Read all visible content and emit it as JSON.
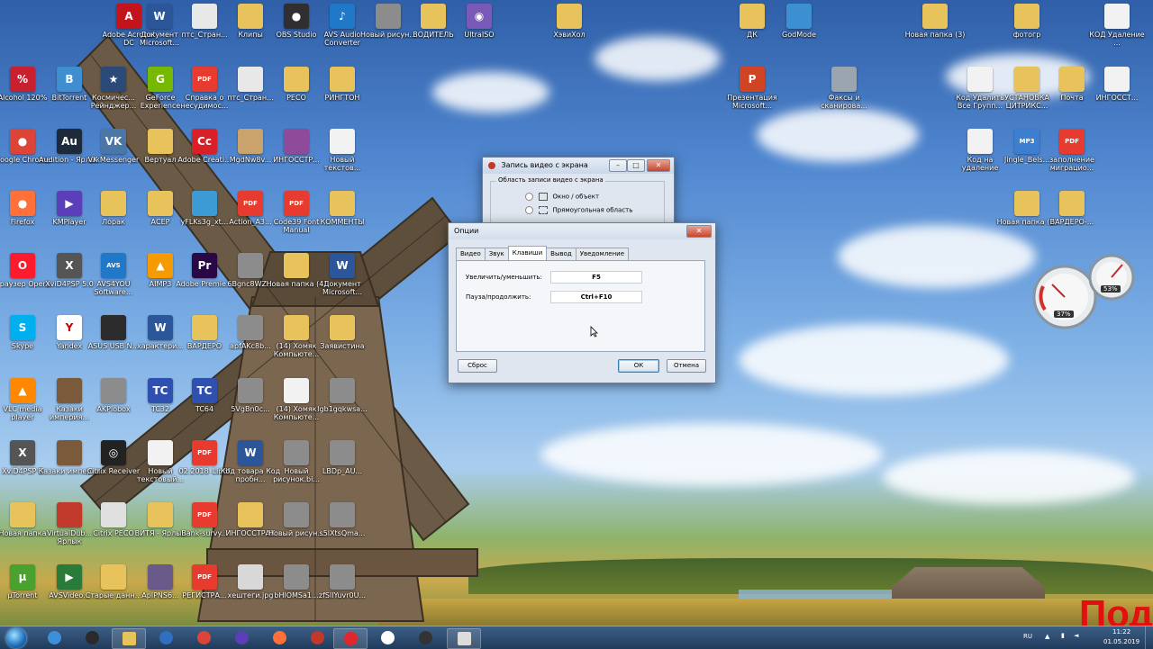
{
  "desktop": {
    "icons": [
      {
        "label": "Adobe Acrobat DC",
        "color": "#c4141b",
        "glyph": "A"
      },
      {
        "label": "Документ Microsoft...",
        "color": "#2b579a",
        "glyph": "W"
      },
      {
        "label": "птс_Стран...",
        "color": "#e8e8e8",
        "glyph": ""
      },
      {
        "label": "Клипы",
        "color": "#e8c25a",
        "glyph": ""
      },
      {
        "label": "OBS Studio",
        "color": "#302e31",
        "glyph": "●"
      },
      {
        "label": "AVS Audio Converter",
        "color": "#1f78c8",
        "glyph": "♪"
      },
      {
        "label": "Новый рисун...",
        "color": "#8c8c8c",
        "glyph": ""
      },
      {
        "label": "ВОДИТЕЛЬ",
        "color": "#e8c25a",
        "glyph": ""
      },
      {
        "label": "UltraISO",
        "color": "#7a5ab8",
        "glyph": "◉"
      },
      {
        "label": "ХэвиХол",
        "color": "#e8c25a",
        "glyph": ""
      },
      {
        "label": "ДК",
        "color": "#e8c25a",
        "glyph": ""
      },
      {
        "label": "GodMode",
        "color": "#3c8fd0",
        "glyph": ""
      },
      {
        "label": "Новая папка (3)",
        "color": "#e8c25a",
        "glyph": ""
      },
      {
        "label": "фотогр",
        "color": "#e8c25a",
        "glyph": ""
      },
      {
        "label": "КОД Удаление ...",
        "color": "#f2f2f2",
        "glyph": ""
      },
      {
        "label": "Alcohol 120%",
        "color": "#c8202f",
        "glyph": "%"
      },
      {
        "label": "BitTorrent",
        "color": "#3e8ed0",
        "glyph": "B"
      },
      {
        "label": "Космичес... Рейнджер...",
        "color": "#2b4a77",
        "glyph": "★"
      },
      {
        "label": "GeForce Experience",
        "color": "#76b900",
        "glyph": "G"
      },
      {
        "label": "Справка о несудимос...",
        "color": "#e63b2e",
        "glyph": "PDF"
      },
      {
        "label": "птс_Стран...",
        "color": "#e8e8e8",
        "glyph": ""
      },
      {
        "label": "РЕСО",
        "color": "#e8c25a",
        "glyph": ""
      },
      {
        "label": "РИНГТОН",
        "color": "#e8c25a",
        "glyph": ""
      },
      {
        "label": "Презентация Microsoft...",
        "color": "#d04423",
        "glyph": "P"
      },
      {
        "label": "Факсы и сканирова...",
        "color": "#9aa5b0",
        "glyph": ""
      },
      {
        "label": "Код Удалить Все Групп...",
        "color": "#f2f2f2",
        "glyph": ""
      },
      {
        "label": "УСТАНОВКА ЦИТРИКС...",
        "color": "#e8c25a",
        "glyph": ""
      },
      {
        "label": "Почта",
        "color": "#e8c25a",
        "glyph": ""
      },
      {
        "label": "ИНГОССТ...",
        "color": "#f2f2f2",
        "glyph": ""
      },
      {
        "label": "Google Chrome",
        "color": "#db4437",
        "glyph": "●"
      },
      {
        "label": "Audition - Ярлык",
        "color": "#1d2a3b",
        "glyph": "Au"
      },
      {
        "label": "VK Messenger",
        "color": "#4a76a8",
        "glyph": "VK"
      },
      {
        "label": "Вертуал",
        "color": "#e8c25a",
        "glyph": ""
      },
      {
        "label": "Adobe Creati...",
        "color": "#da1f26",
        "glyph": "Cc"
      },
      {
        "label": "MgdNw8v...",
        "color": "#c9a36b",
        "glyph": ""
      },
      {
        "label": "ИНГОССТР...",
        "color": "#8e4b9a",
        "glyph": ""
      },
      {
        "label": "Новый текстов...",
        "color": "#f2f2f2",
        "glyph": ""
      },
      {
        "label": "Код на удаление",
        "color": "#f2f2f2",
        "glyph": ""
      },
      {
        "label": "Jingle_Bels...",
        "color": "#3c7fd0",
        "glyph": "MP3"
      },
      {
        "label": "заполнение миграцио...",
        "color": "#e63b2e",
        "glyph": "PDF"
      },
      {
        "label": "Firefox",
        "color": "#ff7139",
        "glyph": "●"
      },
      {
        "label": "KMPlayer",
        "color": "#5b3fb8",
        "glyph": "▶"
      },
      {
        "label": "Лорак",
        "color": "#e8c25a",
        "glyph": ""
      },
      {
        "label": "АСЕР",
        "color": "#e8c25a",
        "glyph": ""
      },
      {
        "label": "yFLKs3g_xt...",
        "color": "#3c9bd4",
        "glyph": ""
      },
      {
        "label": "Action_A3...",
        "color": "#e63b2e",
        "glyph": "PDF"
      },
      {
        "label": "Code39 Font Manual",
        "color": "#e63b2e",
        "glyph": "PDF"
      },
      {
        "label": "КОММЕНТЫ",
        "color": "#e8c25a",
        "glyph": ""
      },
      {
        "label": "Новая папка (2)",
        "color": "#e8c25a",
        "glyph": ""
      },
      {
        "label": "ВАРДЕРО-...",
        "color": "#e8c25a",
        "glyph": ""
      },
      {
        "label": "Браузер Opera",
        "color": "#ff1b2d",
        "glyph": "O"
      },
      {
        "label": "XviD4PSP 5.0",
        "color": "#555555",
        "glyph": "X"
      },
      {
        "label": "AVS4YOU Software...",
        "color": "#1f78c8",
        "glyph": "AVS"
      },
      {
        "label": "AIMP3",
        "color": "#f59b00",
        "glyph": "▲"
      },
      {
        "label": "Adobe Premie...",
        "color": "#2a0845",
        "glyph": "Pr"
      },
      {
        "label": "6Bgnc8WZ...",
        "color": "#8c8c8c",
        "glyph": ""
      },
      {
        "label": "Новая папка (4)",
        "color": "#e8c25a",
        "glyph": ""
      },
      {
        "label": "Документ Microsoft...",
        "color": "#2b579a",
        "glyph": "W"
      },
      {
        "label": "Skype",
        "color": "#00aff0",
        "glyph": "S"
      },
      {
        "label": "Yandex",
        "color": "#ffffff",
        "glyph": "Y"
      },
      {
        "label": "ASUS USB N...",
        "color": "#2c2c2c",
        "glyph": ""
      },
      {
        "label": "характери...",
        "color": "#2b579a",
        "glyph": "W"
      },
      {
        "label": "ВАРДЕРО",
        "color": "#e8c25a",
        "glyph": ""
      },
      {
        "label": "apfAKc8b...",
        "color": "#8c8c8c",
        "glyph": ""
      },
      {
        "label": "(14) Хомяк Компьюте...",
        "color": "#e8c25a",
        "glyph": ""
      },
      {
        "label": "Заявистина",
        "color": "#e8c25a",
        "glyph": ""
      },
      {
        "label": "VLC media player",
        "color": "#ff8800",
        "glyph": "▲"
      },
      {
        "label": "Казаки империя...",
        "color": "#7a5a3a",
        "glyph": ""
      },
      {
        "label": "AKPlobox",
        "color": "#8c8c8c",
        "glyph": ""
      },
      {
        "label": "TC32",
        "color": "#3050b0",
        "glyph": "TC"
      },
      {
        "label": "TC64",
        "color": "#3050b0",
        "glyph": "TC"
      },
      {
        "label": "5VgBn0c...",
        "color": "#8c8c8c",
        "glyph": ""
      },
      {
        "label": "(14) Хомяк Компьюте...",
        "color": "#f2f2f2",
        "glyph": ""
      },
      {
        "label": "Igb1gqkwsa...",
        "color": "#8c8c8c",
        "glyph": ""
      },
      {
        "label": "XviD4PSP 5",
        "color": "#555555",
        "glyph": "X"
      },
      {
        "label": "Казаки империя",
        "color": "#7a5a3a",
        "glyph": ""
      },
      {
        "label": "Citrix Receiver",
        "color": "#222222",
        "glyph": "◎"
      },
      {
        "label": "Новый текстовый...",
        "color": "#f2f2f2",
        "glyph": ""
      },
      {
        "label": "02.2018_Lipdf",
        "color": "#e63b2e",
        "glyph": "PDF"
      },
      {
        "label": "Код товара Код пробн...",
        "color": "#2b579a",
        "glyph": "W"
      },
      {
        "label": "Новый рисунок.bi...",
        "color": "#8c8c8c",
        "glyph": ""
      },
      {
        "label": "LBDp_AU...",
        "color": "#8c8c8c",
        "glyph": ""
      },
      {
        "label": "Новая папка",
        "color": "#e8c25a",
        "glyph": ""
      },
      {
        "label": "VirtualDub... Ярлык",
        "color": "#c0392b",
        "glyph": ""
      },
      {
        "label": "Citrix РЕСО",
        "color": "#e0e0e0",
        "glyph": ""
      },
      {
        "label": "ВИТЯ - Ярлык",
        "color": "#e8c25a",
        "glyph": ""
      },
      {
        "label": "Bank-survy...",
        "color": "#e63b2e",
        "glyph": "PDF"
      },
      {
        "label": "ИНГОССТРАХ",
        "color": "#e8c25a",
        "glyph": ""
      },
      {
        "label": "Новый рисун...",
        "color": "#8c8c8c",
        "glyph": ""
      },
      {
        "label": "s5lXtsQma...",
        "color": "#8c8c8c",
        "glyph": ""
      },
      {
        "label": "µTorrent",
        "color": "#49a22e",
        "glyph": "µ"
      },
      {
        "label": "AVSVideo...",
        "color": "#2a7a3a",
        "glyph": "▶"
      },
      {
        "label": "Старые данн...",
        "color": "#e8c25a",
        "glyph": ""
      },
      {
        "label": "AplPNS6...",
        "color": "#6a5a8a",
        "glyph": ""
      },
      {
        "label": "РЕГИСТРА...",
        "color": "#e63b2e",
        "glyph": "PDF"
      },
      {
        "label": "хештеги.jpg",
        "color": "#d8d8d8",
        "glyph": ""
      },
      {
        "label": "bHlOMSa1...",
        "color": "#8c8c8c",
        "glyph": ""
      },
      {
        "label": "zfSllYuvr0U...",
        "color": "#8c8c8c",
        "glyph": ""
      }
    ],
    "overlay_text": "Под"
  },
  "bg_window": {
    "title": "Запись видео с экрана",
    "group_label": "Область записи видео с экрана",
    "opt_window": "Окно / объект",
    "opt_rect": "Прямоугольная область"
  },
  "dialog": {
    "title": "Опции",
    "tabs": [
      "Видео",
      "Звук",
      "Клавиши",
      "Вывод",
      "Уведомление"
    ],
    "active_tab": "Клавиши",
    "zoom_label": "Увеличить/уменьшить:",
    "zoom_key": "F5",
    "pause_label": "Пауза/продолжить:",
    "pause_key": "Ctrl+F10",
    "reset_btn": "Сброс",
    "ok_btn": "ОК",
    "cancel_btn": "Отмена"
  },
  "gadget": {
    "cpu": "37%",
    "ram": "53%"
  },
  "taskbar": {
    "items": [
      {
        "name": "ie",
        "color": "#3c8fd8"
      },
      {
        "name": "obs",
        "color": "#2a2a2a"
      },
      {
        "name": "explorer",
        "color": "#e8c25a"
      },
      {
        "name": "media-player",
        "color": "#2f6fbf"
      },
      {
        "name": "chrome",
        "color": "#db4437"
      },
      {
        "name": "kmplayer",
        "color": "#5b3fb8"
      },
      {
        "name": "firefox",
        "color": "#ff7139"
      },
      {
        "name": "app-red",
        "color": "#c0392b"
      },
      {
        "name": "recorder",
        "color": "#e0272b"
      },
      {
        "name": "yandex",
        "color": "#ffffff"
      },
      {
        "name": "obs-2",
        "color": "#333333"
      },
      {
        "name": "video-editor",
        "color": "#dcdcdc"
      }
    ],
    "lang": "RU",
    "time": "11:22",
    "date": "01.05.2019"
  }
}
